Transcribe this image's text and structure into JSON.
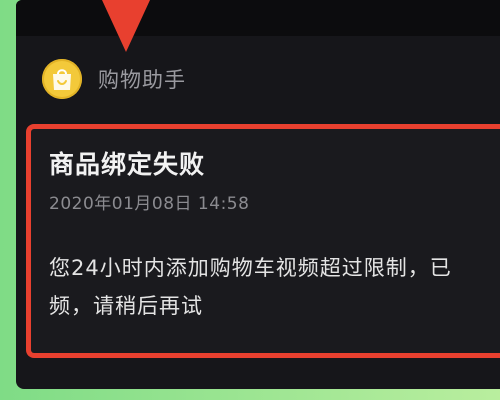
{
  "notification": {
    "sender": "购物助手",
    "avatar_icon": "shopping-bag-smile-icon",
    "title": "商品绑定失败",
    "timestamp": "2020年01月08日 14:58",
    "body_line1": "您24小时内添加购物车视频超过限制，已",
    "body_line2": "频，请稍后再试"
  },
  "colors": {
    "highlight": "#e8402f",
    "background": "#16161a",
    "avatar": "#f3c93a",
    "frame": "#9be38f"
  }
}
